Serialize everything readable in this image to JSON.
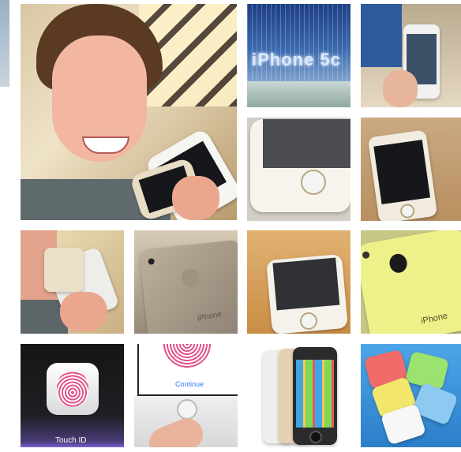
{
  "grid": {
    "thumbnails": [
      {
        "name": "boy-selfie-with-iphones"
      },
      {
        "name": "iphone5c-store-display"
      },
      {
        "name": "hand-holding-iphone-in-store"
      },
      {
        "name": "iphone-home-button-closeup"
      },
      {
        "name": "gold-iphone5s-front"
      },
      {
        "name": "boy-with-silver-iphones"
      },
      {
        "name": "iphone5s-back-closeup"
      },
      {
        "name": "iphone-on-wood-table"
      },
      {
        "name": "yellow-iphone5c-back"
      },
      {
        "name": "touch-id-logo-screen"
      },
      {
        "name": "fingerprint-continue-screen"
      },
      {
        "name": "three-iphone5s-colors"
      },
      {
        "name": "colorful-iphone5c-phones"
      }
    ]
  },
  "texts": {
    "store_display": "iPhone 5c",
    "back_label_5s": "iPhone",
    "back_label_5c": "iPhone",
    "touch_id_label": "Touch ID",
    "continue_label": "Continue"
  },
  "colors": {
    "accent_blue": "#3478f6",
    "gold": "#e6d2b0",
    "yellow_5c": "#eef18a",
    "touch_pink": "#e3528a"
  }
}
